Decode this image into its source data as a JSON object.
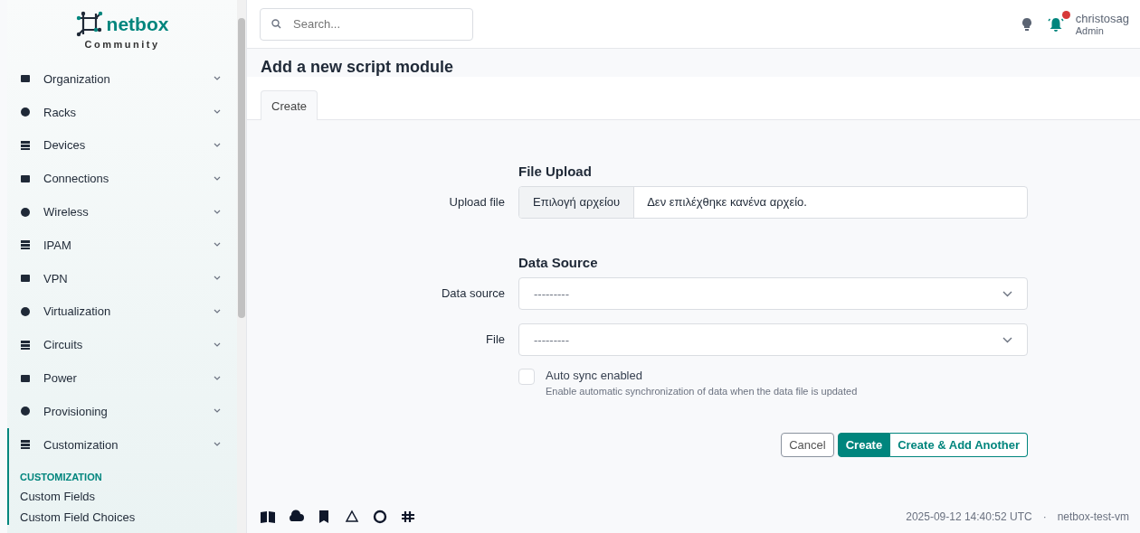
{
  "brand": {
    "name": "netbox",
    "edition": "Community"
  },
  "sidebar": {
    "items": [
      {
        "label": "Organization",
        "expanded": false
      },
      {
        "label": "Racks",
        "expanded": false
      },
      {
        "label": "Devices",
        "expanded": false
      },
      {
        "label": "Connections",
        "expanded": false
      },
      {
        "label": "Wireless",
        "expanded": false
      },
      {
        "label": "IPAM",
        "expanded": false
      },
      {
        "label": "VPN",
        "expanded": false
      },
      {
        "label": "Virtualization",
        "expanded": false
      },
      {
        "label": "Circuits",
        "expanded": false
      },
      {
        "label": "Power",
        "expanded": false
      },
      {
        "label": "Provisioning",
        "expanded": false
      },
      {
        "label": "Customization",
        "expanded": true,
        "group": "CUSTOMIZATION",
        "children": [
          {
            "label": "Custom Fields"
          },
          {
            "label": "Custom Field Choices"
          }
        ]
      }
    ]
  },
  "header": {
    "search": {
      "placeholder": "Search..."
    },
    "user": {
      "name": "christosag",
      "role": "Admin"
    },
    "notifications": {
      "unread": true
    }
  },
  "page": {
    "title": "Add a new script module",
    "tabs": [
      {
        "label": "Create",
        "selected": true
      }
    ]
  },
  "form": {
    "sections": [
      {
        "title": "File Upload",
        "fields": [
          {
            "kind": "file",
            "label": "Upload file",
            "button": "Επιλογή αρχείου",
            "value": "Δεν επιλέχθηκε κανένα αρχείο."
          }
        ]
      },
      {
        "title": "Data Source",
        "fields": [
          {
            "kind": "select",
            "label": "Data source",
            "value": "---------"
          },
          {
            "kind": "select",
            "label": "File",
            "value": "---------"
          },
          {
            "kind": "checkbox",
            "label": "Auto sync enabled",
            "checked": false,
            "help": "Enable automatic synchronization of data when the data file is updated"
          }
        ]
      }
    ],
    "buttons": [
      {
        "label": "Cancel",
        "kind": "outline"
      },
      {
        "label": "Create",
        "kind": "primary"
      },
      {
        "label": "Create & Add Another",
        "kind": "secondary"
      }
    ]
  },
  "footer": {
    "timestamp": "2025-09-12 14:40:52 UTC",
    "separator": "·",
    "host": "netbox-test-vm"
  }
}
